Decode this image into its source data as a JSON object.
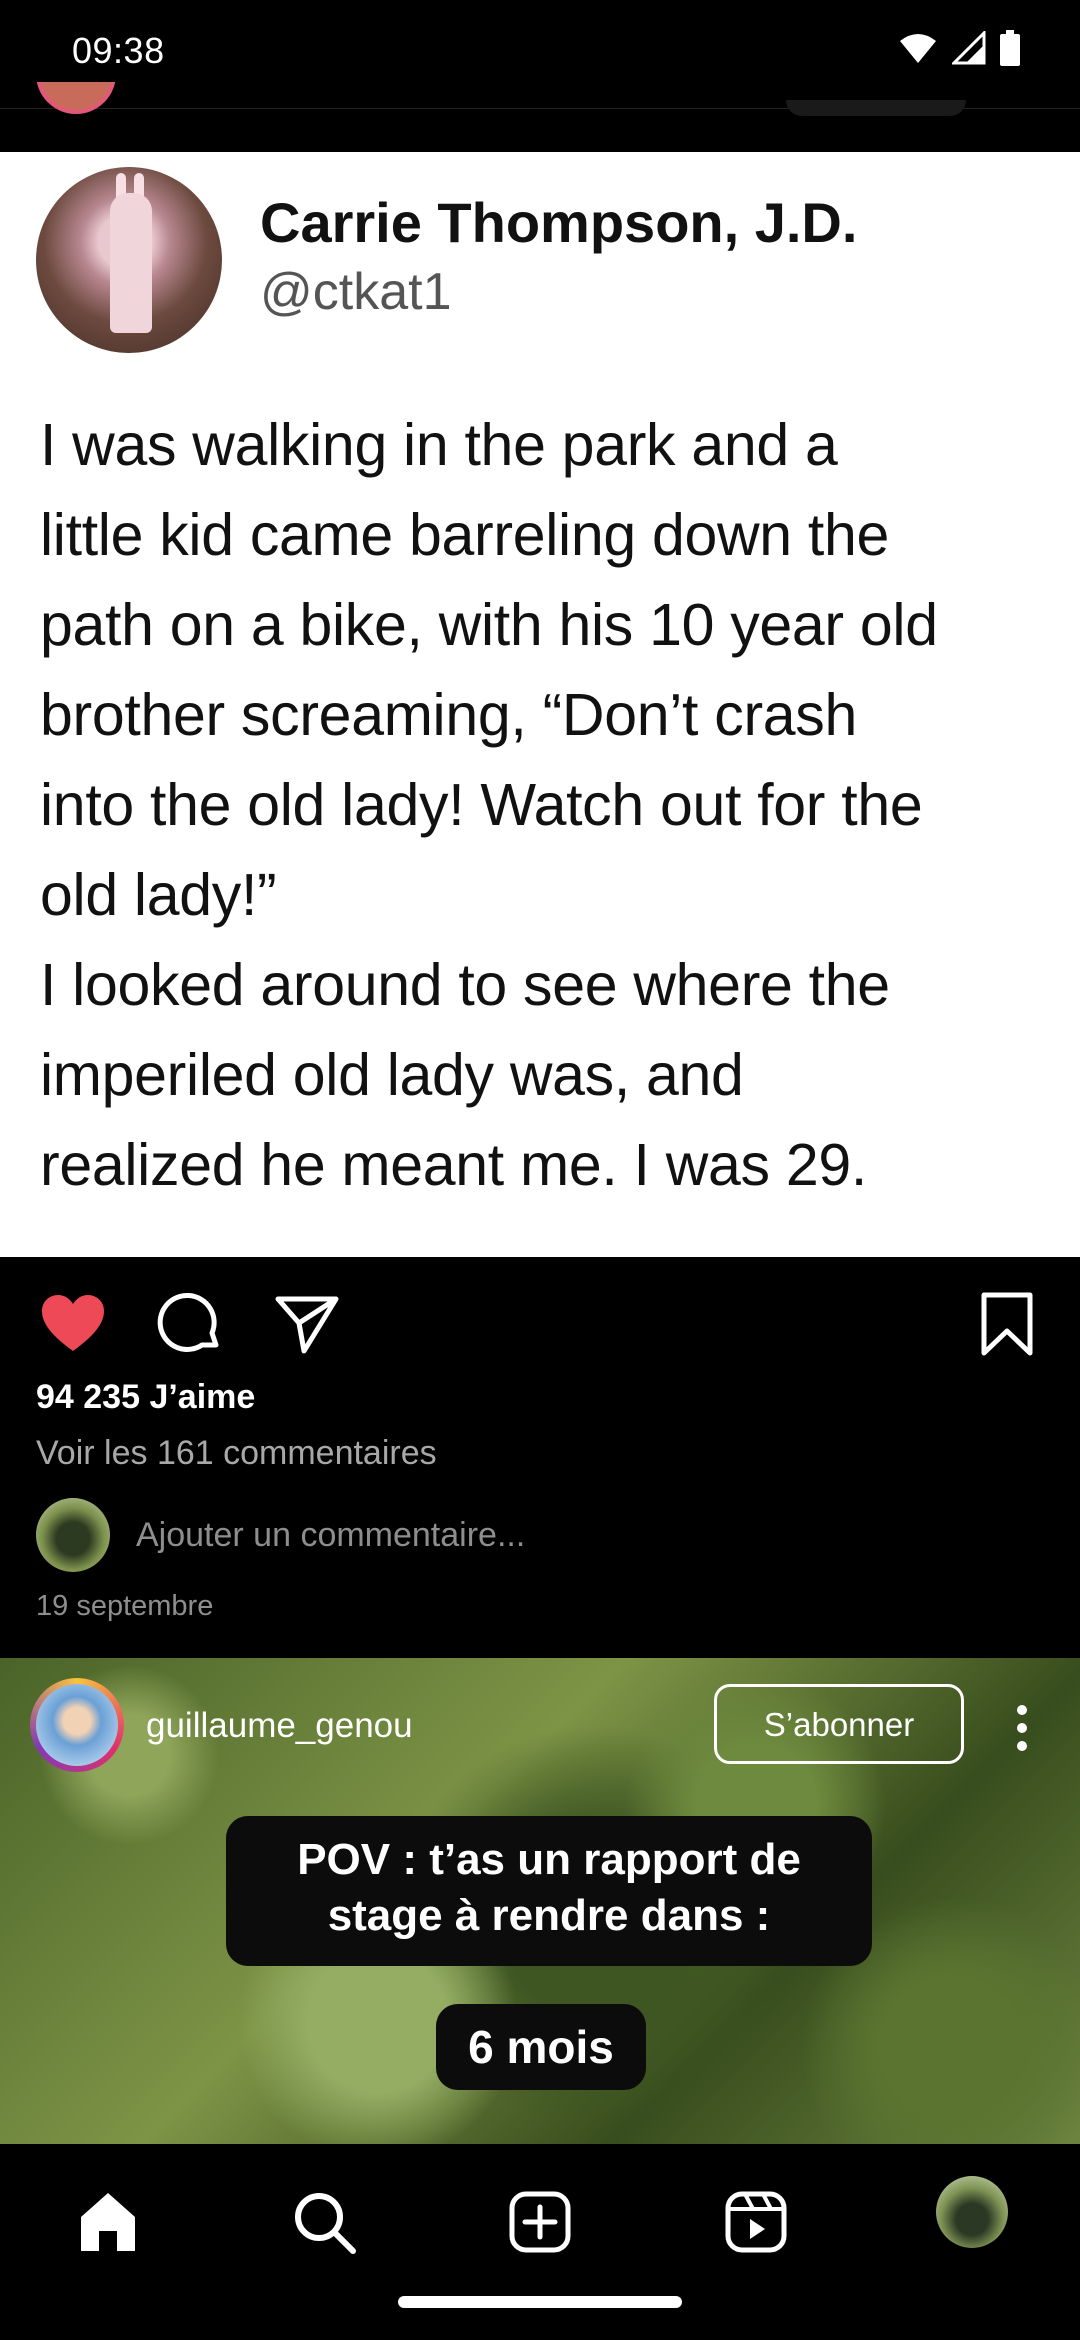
{
  "status_bar": {
    "time": "09:38"
  },
  "post": {
    "tweet": {
      "name": "Carrie Thompson, J.D.",
      "handle": "@ctkat1",
      "text": "I was walking in the park and a\nlittle kid came barreling down the\npath on a bike, with his 10 year old\nbrother screaming, “Don’t crash\ninto the old lady! Watch out for the\nold lady!”\nI looked around to see where the\nimperiled old lady was, and\nrealized he meant me. I was 29."
    },
    "likes": "94 235 J’aime",
    "view_comments": "Voir les 161 commentaires",
    "comment_placeholder": "Ajouter un commentaire...",
    "date": "19 septembre",
    "liked": true
  },
  "next_reel": {
    "username": "guillaume_genou",
    "follow_label": "S’abonner",
    "caption_1": "POV : t’as un rapport de\nstage à rendre dans :",
    "caption_2": "6 mois"
  },
  "colors": {
    "like": "#ed4956",
    "background": "#000000",
    "muted": "#a8a8a8"
  },
  "icons": {
    "like": "heart-icon",
    "comment": "comment-icon",
    "share": "paper-plane-icon",
    "save": "bookmark-icon",
    "home": "home-icon",
    "search": "search-icon",
    "create": "plus-square-icon",
    "reels": "reels-icon",
    "more": "more-vertical-icon"
  }
}
